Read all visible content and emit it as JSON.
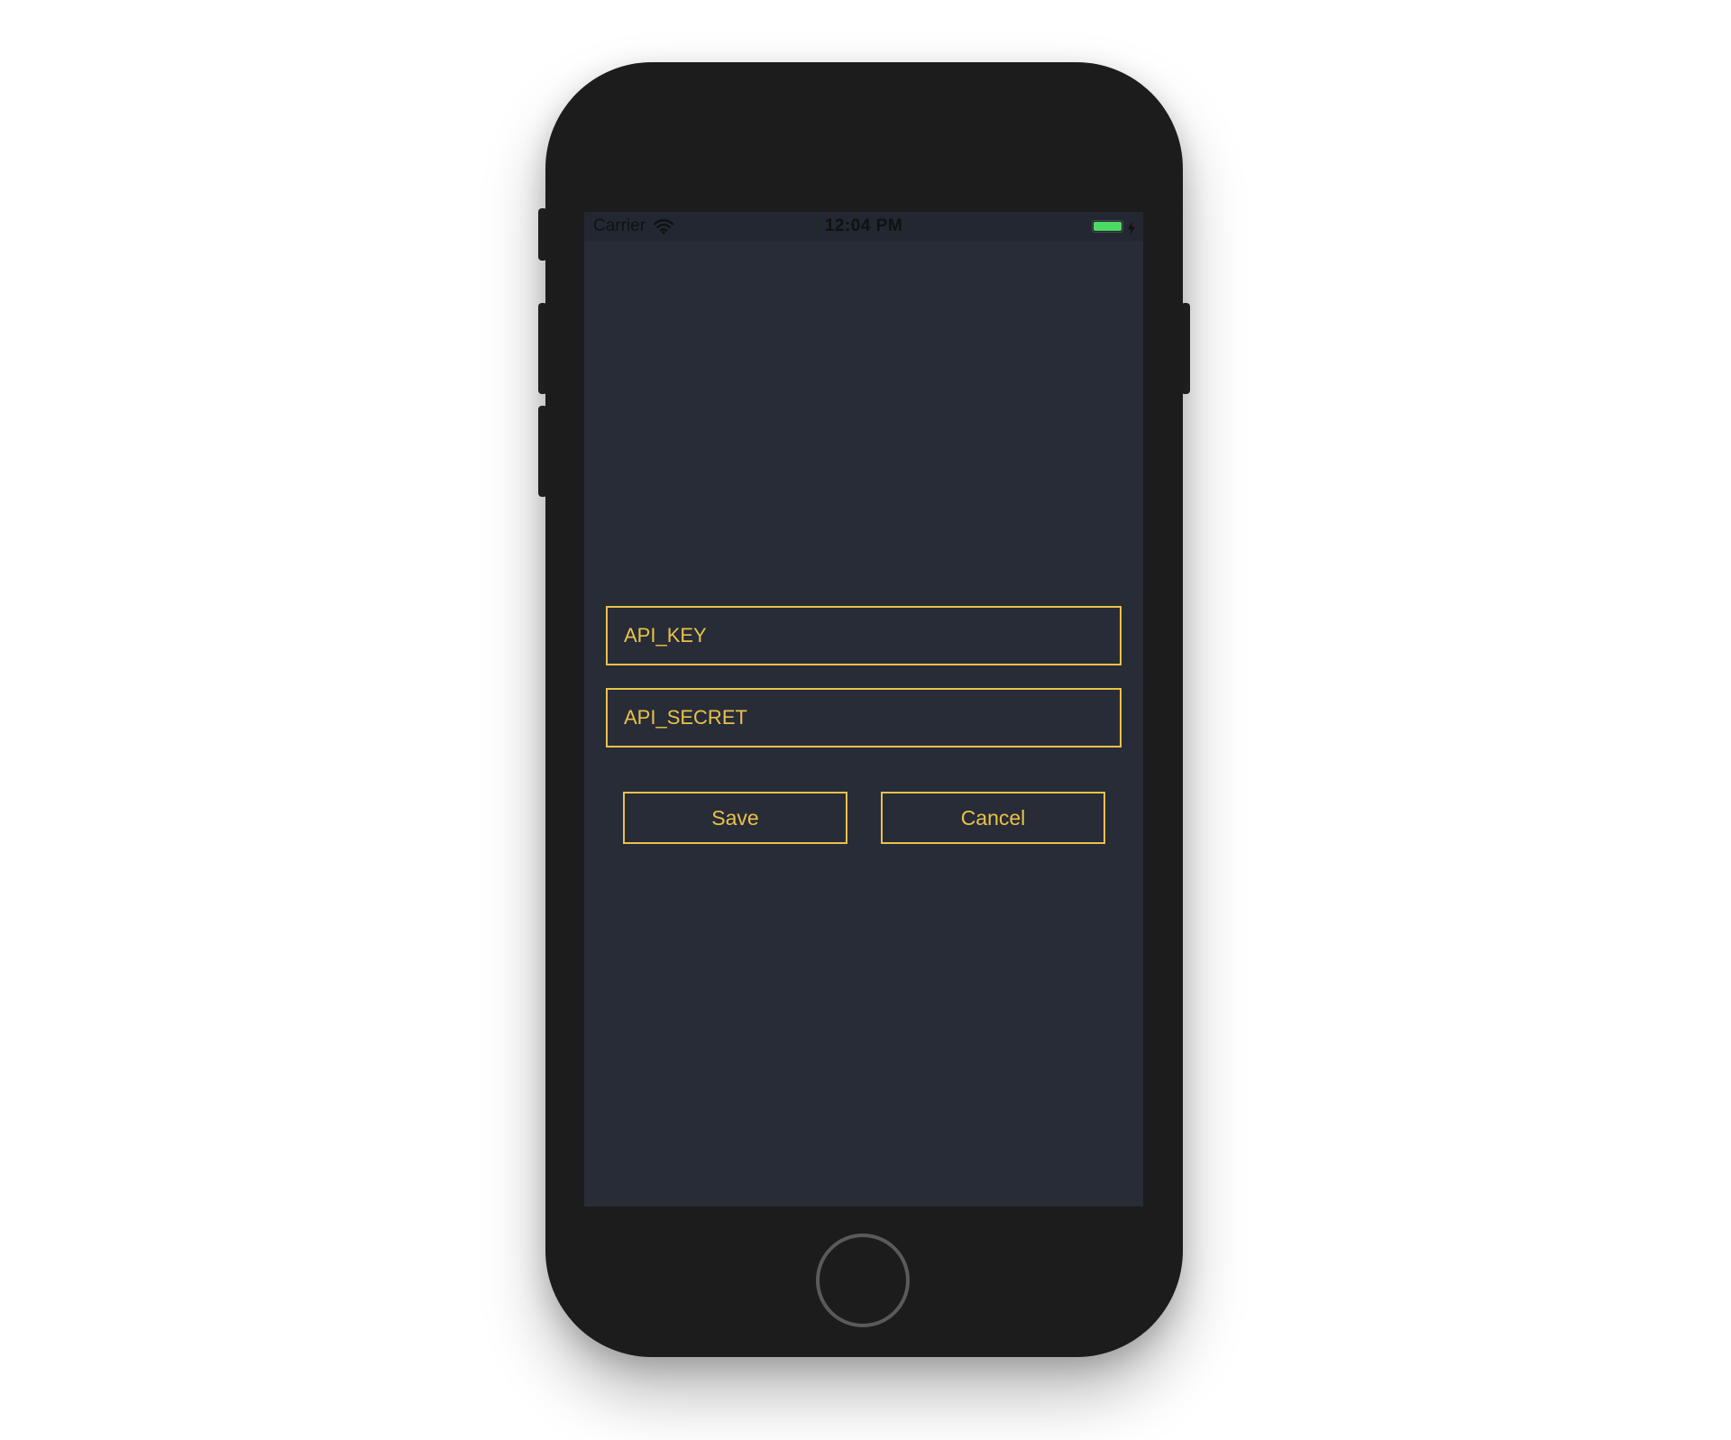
{
  "status_bar": {
    "carrier": "Carrier",
    "time": "12:04 PM",
    "wifi_icon": "wifi-icon",
    "battery_icon": "battery-icon",
    "battery_level": 1.0,
    "charging_icon": "bolt-icon"
  },
  "form": {
    "api_key_placeholder": "API_KEY",
    "api_secret_placeholder": "API_SECRET",
    "save_label": "Save",
    "cancel_label": "Cancel"
  },
  "colors": {
    "accent": "#e8c24a",
    "screen_background": "#282c37",
    "phone_body": "#1c1c1c",
    "battery": "#4cd964"
  }
}
